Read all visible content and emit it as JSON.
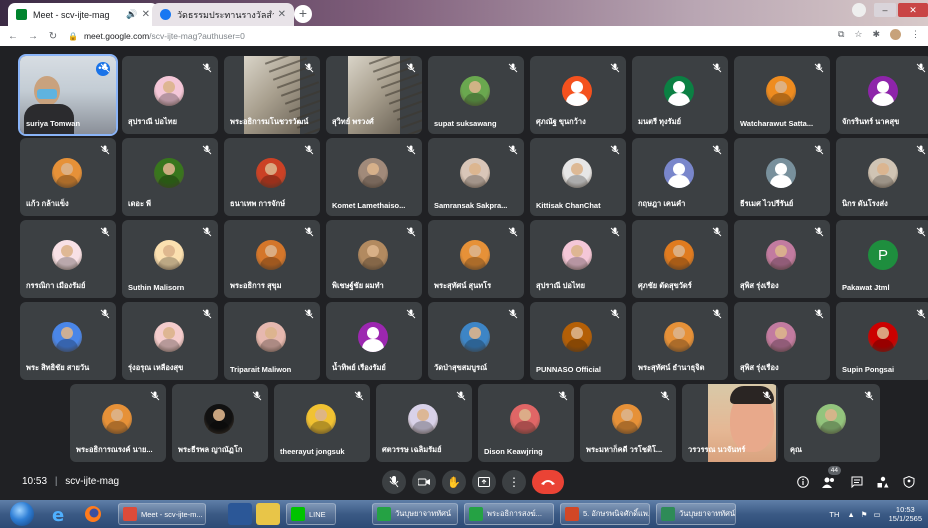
{
  "browser": {
    "tabs": [
      {
        "title": "Meet - scv-ijte-mag",
        "active": true,
        "color": "#00832d"
      },
      {
        "title": "วัดธรรมประทานรางวัลสำนักงานพระพุทธศาสนาแห่งชาติ",
        "active": false,
        "color": "#1877f2"
      }
    ],
    "new_tab_label": "+",
    "address": {
      "host": "meet.google.com",
      "path": "/scv-ijte-mag?authuser=0"
    }
  },
  "meeting": {
    "time": "10:53",
    "code": "scv-ijte-mag",
    "participant_count": "44"
  },
  "participants": [
    {
      "name": "suriya Tomwan",
      "video": true,
      "scene": "self",
      "more_label": "•••"
    },
    {
      "name": "สุปราณี ปอไทย",
      "avatar_color": "#f4c7d8"
    },
    {
      "name": "พระอธิการมโนชวรวัฒน์",
      "video": true,
      "scene": "stairs"
    },
    {
      "name": "สุวิทย์ พรวงศ์",
      "video": true,
      "scene": "stairs2"
    },
    {
      "name": "supat suksawang",
      "avatar_color": "#6aa84f"
    },
    {
      "name": "ศุภณัฐ ขุนกว้าง",
      "avatar_color": "#f4511e",
      "letter_avatar": true
    },
    {
      "name": "มนตรี ทุงรัมย์",
      "avatar_color": "#0b8043",
      "letter_avatar": true
    },
    {
      "name": "Watcharawut Satta...",
      "avatar_color": "#ef8c1f"
    },
    {
      "name": "จักรรินทร์ นาคสุข",
      "avatar_color": "#8e24aa",
      "letter_avatar": true
    },
    {
      "name": "แก้ว กล้าแข็ง",
      "avatar_color": "#e69138"
    },
    {
      "name": "เดอะ พี",
      "avatar_color": "#38761d"
    },
    {
      "name": "ธนาเทพ การจักษ์",
      "avatar_color": "#cc4125"
    },
    {
      "name": "Komet Lamethaiso...",
      "avatar_color": "#a18a7a"
    },
    {
      "name": "Samransak Sakpra...",
      "avatar_color": "#d9c6b8"
    },
    {
      "name": "Kittisak ChanChat",
      "avatar_color": "#e6e6e6"
    },
    {
      "name": "กฤษฎา เคนคำ",
      "avatar_color": "#7986cb",
      "letter_avatar": true
    },
    {
      "name": "ธีรเมศ ไวปรีรันย์",
      "avatar_color": "#78909c",
      "letter_avatar": true
    },
    {
      "name": "นิกร ดันโรงส่ง",
      "avatar_color": "#d0c4b4"
    },
    {
      "name": "กรรณิกา เมืองรัมย์",
      "avatar_color": "#f8e1e6"
    },
    {
      "name": "Suthin Malisorn",
      "avatar_color": "#fbe0b0"
    },
    {
      "name": "พระอธิการ สุขุม",
      "avatar_color": "#d4762a"
    },
    {
      "name": "พิเชษฐ์ชัย ผมทำ",
      "avatar_color": "#b28a60"
    },
    {
      "name": "พระสุทัศน์ สุนทโร",
      "avatar_color": "#e69138"
    },
    {
      "name": "สุปราณี ปอไทย",
      "avatar_color": "#f4c7d8"
    },
    {
      "name": "ศุภชัย ตัดสุขวัดร์",
      "avatar_color": "#e07b1f"
    },
    {
      "name": "สุพิส รุ่งเรือง",
      "avatar_color": "#c27ba0"
    },
    {
      "name": "Pakawat Jtml",
      "avatar_color": "#1e8e3e",
      "letter": "P"
    },
    {
      "name": "พระ สิทธิชัย สายวัน",
      "avatar_color": "#4a86e8"
    },
    {
      "name": "รุ่งอรุณ เหลืองสุข",
      "avatar_color": "#f4cccc"
    },
    {
      "name": "Triparait Maliwon",
      "avatar_color": "#e6b8af"
    },
    {
      "name": "น้ำทิพย์ เรืองรัมย์",
      "avatar_color": "#9c27b0",
      "letter_avatar": true
    },
    {
      "name": "วัดป่าสุขสมบูรณ์",
      "avatar_color": "#3d85c6"
    },
    {
      "name": "PUNNASO Official",
      "avatar_color": "#b45f06"
    },
    {
      "name": "พระสุทัศน์ ธำนาธุจิต",
      "avatar_color": "#e69138"
    },
    {
      "name": "สุพิส รุ่งเรือง",
      "avatar_color": "#c27ba0"
    },
    {
      "name": "Supin Pongsai",
      "avatar_color": "#cc0000"
    },
    {
      "name": "พระอธิการณรงค์ นาย...",
      "avatar_color": "#e69138"
    },
    {
      "name": "พระธีรพล ญาณัฏโก",
      "avatar_color": "#111111"
    },
    {
      "name": "theerayut jongsuk",
      "avatar_color": "#f1c232"
    },
    {
      "name": "ศตวรรษ เฉลิมรัมย์",
      "avatar_color": "#d9d2e9"
    },
    {
      "name": "Dison Keawjring",
      "avatar_color": "#e06666"
    },
    {
      "name": "พระมหาก็คดี วรโชติโ...",
      "avatar_color": "#e69138"
    },
    {
      "name": "วรวรรณ นวจันทร์",
      "video": true,
      "scene": "face"
    },
    {
      "name": "คุณ",
      "avatar_color": "#93c47d"
    }
  ],
  "controls": {
    "mic": "mic-icon",
    "camera": "camera-icon",
    "hand": "raise-hand-icon",
    "present": "present-icon",
    "more": "more-vert-icon",
    "hangup": "hangup-icon",
    "info": "info-icon",
    "people": "people-icon",
    "chat": "chat-icon",
    "activities": "activities-icon",
    "lock": "host-controls-icon"
  },
  "taskbar": {
    "tasks": [
      {
        "label": "Meet - scv-ijte-m...",
        "color": "#dd4b39"
      },
      {
        "label": "LINE",
        "color": "#00c300"
      },
      {
        "label": "วันบุษยาจาททัศน์",
        "color": "#25a244"
      },
      {
        "label": "พระอธิการสงฆ์...",
        "color": "#25a244"
      },
      {
        "label": "5. อักษรพนิจศักดิ์แพ...",
        "color": "#d24726"
      },
      {
        "label": "วันบุษยาจาททัศน์",
        "color": "#2e8b57"
      }
    ],
    "lang": "TH",
    "time": "10:53",
    "date": "15/1/2565"
  },
  "colors": {
    "background": "#202124",
    "tile": "#3c4043",
    "hangup": "#ea4335",
    "accent": "#1a73e8"
  }
}
